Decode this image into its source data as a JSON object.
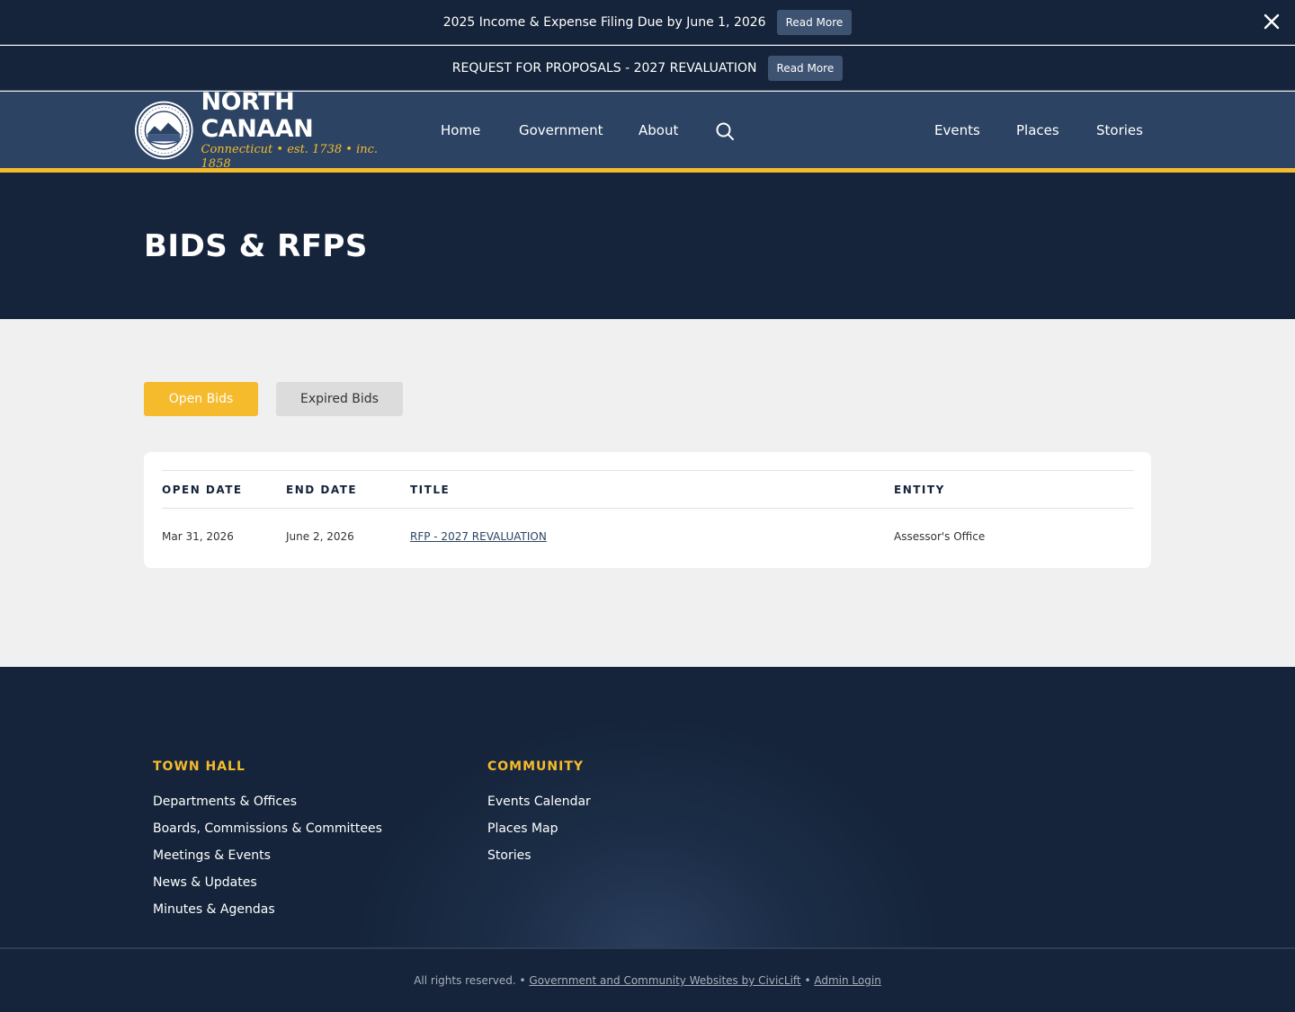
{
  "alerts": [
    {
      "text": "2025 Income & Expense Filing Due by June 1, 2026",
      "button": "Read More"
    },
    {
      "text": "REQUEST FOR PROPOSALS - 2027 REVALUATION",
      "button": "Read More"
    }
  ],
  "logo": {
    "name": "NORTH CANAAN",
    "tagline": "Connecticut  •  est. 1738 • inc. 1858"
  },
  "nav": {
    "home": "Home",
    "government": "Government",
    "about": "About",
    "events": "Events",
    "places": "Places",
    "stories": "Stories"
  },
  "page": {
    "title": "BIDS & RFPS"
  },
  "tabs": {
    "open": "Open Bids",
    "expired": "Expired Bids"
  },
  "table": {
    "headers": {
      "open_date": "OPEN DATE",
      "end_date": "END DATE",
      "title": "TITLE",
      "entity": "ENTITY"
    },
    "rows": [
      {
        "open_date": "Mar 31, 2026",
        "end_date": "June 2, 2026",
        "title": "RFP - 2027 REVALUATION",
        "entity": "Assessor's Office"
      }
    ]
  },
  "footer": {
    "town_hall": {
      "heading": "TOWN HALL",
      "links": [
        "Departments & Offices",
        "Boards, Commissions & Committees",
        "Meetings & Events",
        "News & Updates",
        "Minutes & Agendas"
      ]
    },
    "community": {
      "heading": "COMMUNITY",
      "links": [
        "Events Calendar",
        "Places Map",
        "Stories"
      ]
    }
  },
  "bottom": {
    "rights": "All rights reserved. •",
    "civiclift": "Government and Community Websites by CivicLift",
    "separator": "•",
    "admin": "Admin Login"
  },
  "colors": {
    "navy": "#15243a",
    "header_blue": "#2c4363",
    "accent_gold": "#f6bb2c"
  }
}
